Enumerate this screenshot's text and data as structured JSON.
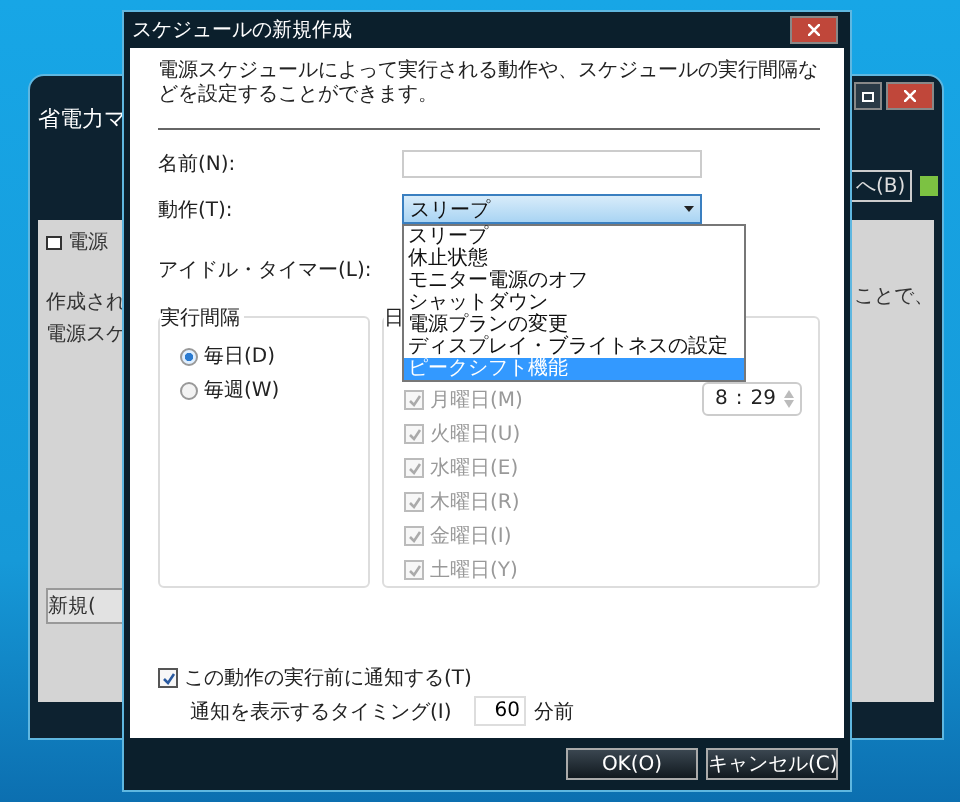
{
  "background_window": {
    "title": "省電力マ",
    "tab": "電源",
    "text_lines": [
      "作成され",
      "電源スケ"
    ],
    "text_right": "ことで、",
    "new_button": "新規(",
    "back_button": "へ(B)"
  },
  "dialog": {
    "title": "スケジュールの新規作成",
    "description": "電源スケジュールによって実行される動作や、スケジュールの実行間隔などを設定することができます。",
    "name_label": "名前(N):",
    "action_label": "動作(T):",
    "action_value": "スリープ",
    "idle_label": "アイドル・タイマー(L):",
    "action_options": [
      {
        "label": "スリープ",
        "selected": false
      },
      {
        "label": "休止状態",
        "selected": false
      },
      {
        "label": "モニター電源のオフ",
        "selected": false
      },
      {
        "label": "シャットダウン",
        "selected": false
      },
      {
        "label": "電源プランの変更",
        "selected": false
      },
      {
        "label": "ディスプレイ・ブライトネスの設定",
        "selected": false
      },
      {
        "label": "ピークシフト機能",
        "selected": true
      }
    ],
    "interval_group": {
      "title": "実行間隔",
      "options": [
        {
          "label": "毎日(D)",
          "selected": true
        },
        {
          "label": "毎週(W)",
          "selected": false
        }
      ]
    },
    "day_group": {
      "title": "日",
      "time": {
        "hour": "8",
        "separator": ":",
        "minute": "29"
      },
      "days": [
        {
          "label": "月曜日(M)",
          "checked": true,
          "disabled": true
        },
        {
          "label": "火曜日(U)",
          "checked": true,
          "disabled": true
        },
        {
          "label": "水曜日(E)",
          "checked": true,
          "disabled": true
        },
        {
          "label": "木曜日(R)",
          "checked": true,
          "disabled": true
        },
        {
          "label": "金曜日(I)",
          "checked": true,
          "disabled": true
        },
        {
          "label": "土曜日(Y)",
          "checked": true,
          "disabled": true
        }
      ]
    },
    "notify": {
      "label": "この動作の実行前に通知する(T)",
      "checked": true
    },
    "timing": {
      "label": "通知を表示するタイミング(I)",
      "value": "60",
      "unit": "分前"
    },
    "buttons": [
      "OK(O)",
      "キャンセル(C)"
    ]
  }
}
